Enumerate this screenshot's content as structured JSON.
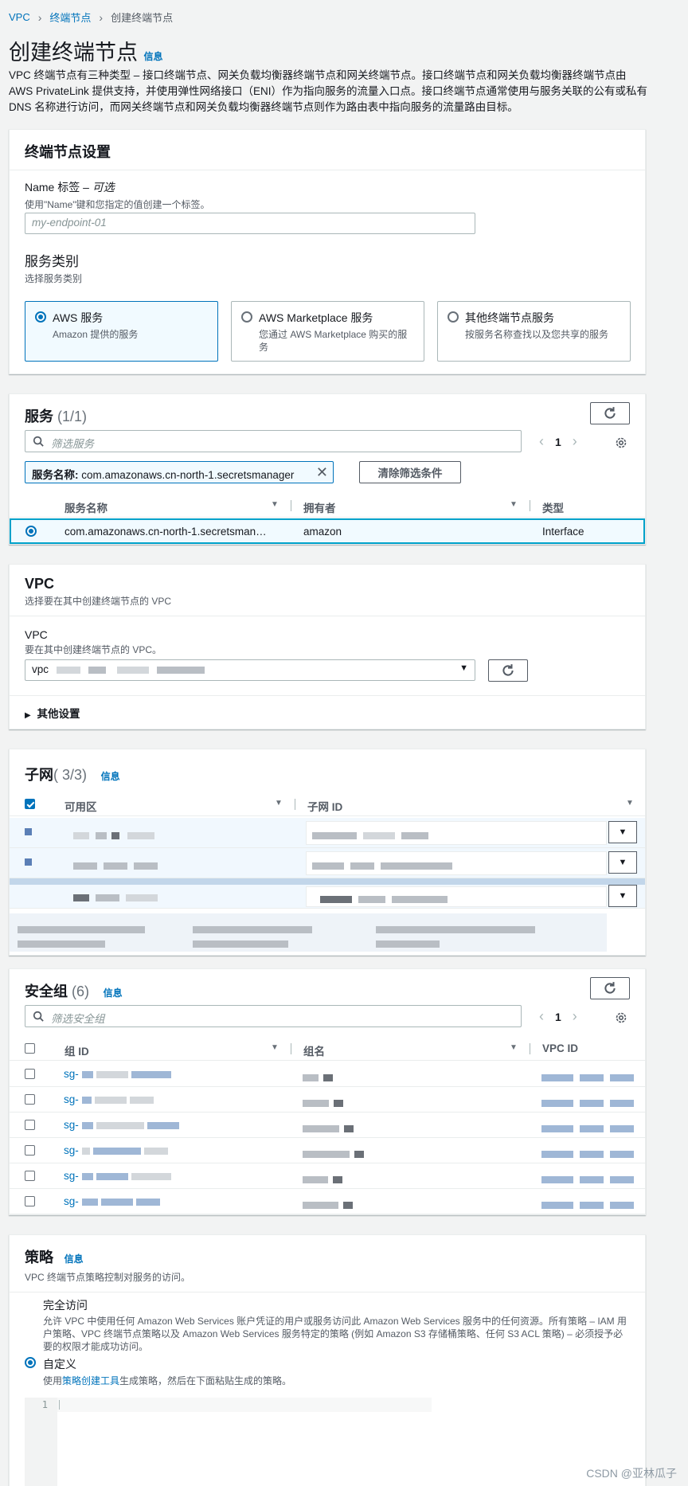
{
  "breadcrumb": {
    "items": [
      "VPC",
      "终端节点",
      "创建终端节点"
    ]
  },
  "header": {
    "title": "创建终端节点",
    "info": "信息",
    "intro": "VPC 终端节点有三种类型 – 接口终端节点、网关负载均衡器终端节点和网关终端节点。接口终端节点和网关负载均衡器终端节点由 AWS PrivateLink 提供支持，并使用弹性网络接口（ENI）作为指向服务的流量入口点。接口终端节点通常使用与服务关联的公有或私有 DNS 名称进行访问，而网关终端节点和网关负载均衡器终端节点则作为路由表中指向服务的流量路由目标。"
  },
  "settings": {
    "title": "终端节点设置",
    "name_label": "Name 标签 – ",
    "name_optional": "可选",
    "name_desc": "使用\"Name\"键和您指定的值创建一个标签。",
    "name_placeholder": "my-endpoint-01",
    "category_label": "服务类别",
    "category_desc": "选择服务类别",
    "tiles": [
      {
        "title": "AWS 服务",
        "desc": "Amazon 提供的服务",
        "selected": true
      },
      {
        "title": "AWS Marketplace 服务",
        "desc": "您通过 AWS Marketplace 购买的服务",
        "selected": false
      },
      {
        "title": "其他终端节点服务",
        "desc": "按服务名称查找以及您共享的服务",
        "selected": false
      }
    ]
  },
  "services": {
    "title": "服务",
    "count": "(1/1)",
    "search_placeholder": "筛选服务",
    "page": "1",
    "token_key": "服务名称: ",
    "token_value": "com.amazonaws.cn-north-1.secretsmanager",
    "clear_label": "清除筛选条件",
    "columns": [
      "服务名称",
      "拥有者",
      "类型"
    ],
    "rows": [
      {
        "name": "com.amazonaws.cn-north-1.secretsman…",
        "owner": "amazon",
        "type": "Interface",
        "selected": true
      }
    ]
  },
  "vpc": {
    "title": "VPC",
    "desc": "选择要在其中创建终端节点的 VPC",
    "field_label": "VPC",
    "field_desc": "要在其中创建终端节点的 VPC。",
    "value_prefix": "vpc",
    "more_settings": "其他设置"
  },
  "subnets": {
    "title": "子网",
    "count": "( 3/3)",
    "info": "信息",
    "columns": [
      "可用区",
      "子网 ID"
    ]
  },
  "security_groups": {
    "title": "安全组",
    "count": "(6)",
    "info": "信息",
    "search_placeholder": "筛选安全组",
    "page": "1",
    "columns": [
      "组 ID",
      "组名",
      "VPC ID"
    ],
    "row_prefix": "sg-",
    "row_count": 6
  },
  "policy": {
    "title": "策略",
    "info": "信息",
    "desc": "VPC 终端节点策略控制对服务的访问。",
    "full_title": "完全访问",
    "full_desc": "允许 VPC 中使用任何 Amazon Web Services 账户凭证的用户或服务访问此 Amazon Web Services 服务中的任何资源。所有策略 – IAM 用户策略、VPC 终端节点策略以及 Amazon Web Services 服务特定的策略 (例如 Amazon S3 存储桶策略、任何 S3 ACL 策略) – 必须授予必要的权限才能成功访问。",
    "custom_title": "自定义",
    "custom_desc_pre": "使用",
    "custom_desc_link": "策略创建工具",
    "custom_desc_post": "生成策略，然后在下面粘贴生成的策略。",
    "line_number": "1"
  },
  "watermark": "CSDN @亚林瓜子"
}
